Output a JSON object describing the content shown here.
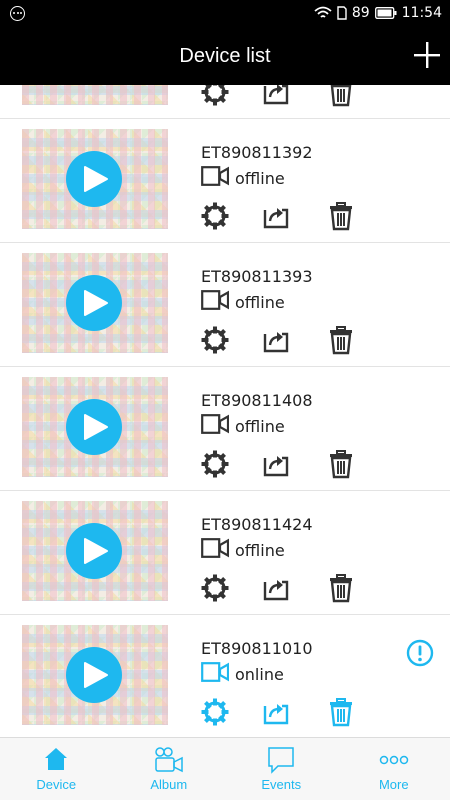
{
  "status_bar": {
    "battery": "89",
    "time": "11:54"
  },
  "header": {
    "title": "Device list",
    "add_icon": "plus-icon"
  },
  "devices": [
    {
      "name": "",
      "status": "",
      "partial": true
    },
    {
      "name": "ET890811392",
      "status": "offline"
    },
    {
      "name": "ET890811393",
      "status": "offline"
    },
    {
      "name": "ET890811408",
      "status": "offline"
    },
    {
      "name": "ET890811424",
      "status": "offline"
    },
    {
      "name": "ET890811010",
      "status": "online",
      "has_alert": true
    }
  ],
  "tabs": [
    {
      "label": "Device",
      "icon": "home-icon",
      "active": true
    },
    {
      "label": "Album",
      "icon": "video-camera-icon"
    },
    {
      "label": "Events",
      "icon": "message-icon"
    },
    {
      "label": "More",
      "icon": "more-dots-icon"
    }
  ],
  "colors": {
    "accent": "#1eb8ef",
    "icon_gray": "#333333",
    "header_bg": "#000000"
  }
}
